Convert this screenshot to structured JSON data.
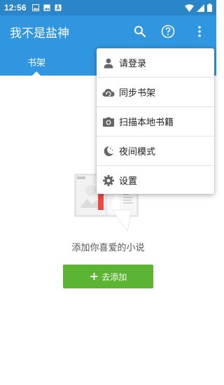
{
  "status_bar": {
    "time": "12:56",
    "notification_icons": [
      "image-icon",
      "image-icon",
      "font-icon"
    ],
    "system_icons": [
      "wifi-icon",
      "signal-icon",
      "battery-icon"
    ]
  },
  "app_bar": {
    "title": "我不是盐神",
    "actions": [
      "search-icon",
      "help-icon",
      "more-vert-icon"
    ]
  },
  "tabs": {
    "items": [
      {
        "label": "书架",
        "selected": true
      }
    ]
  },
  "empty_state": {
    "message": "添加你喜爱的小说",
    "button_label": "去添加",
    "button_icon": "plus-icon"
  },
  "overflow_menu": {
    "items": [
      {
        "label": "请登录",
        "icon": "person-icon"
      },
      {
        "label": "同步书架",
        "icon": "cloud-sync-icon"
      },
      {
        "label": "扫描本地书籍",
        "icon": "camera-icon"
      },
      {
        "label": "夜间模式",
        "icon": "moon-icon"
      },
      {
        "label": "设置",
        "icon": "gear-icon"
      }
    ]
  },
  "colors": {
    "status_bar": "#2a86c9",
    "primary": "#3096e0",
    "accent_green": "#5cb532",
    "text_dark": "#222222",
    "text_muted": "#555555"
  }
}
